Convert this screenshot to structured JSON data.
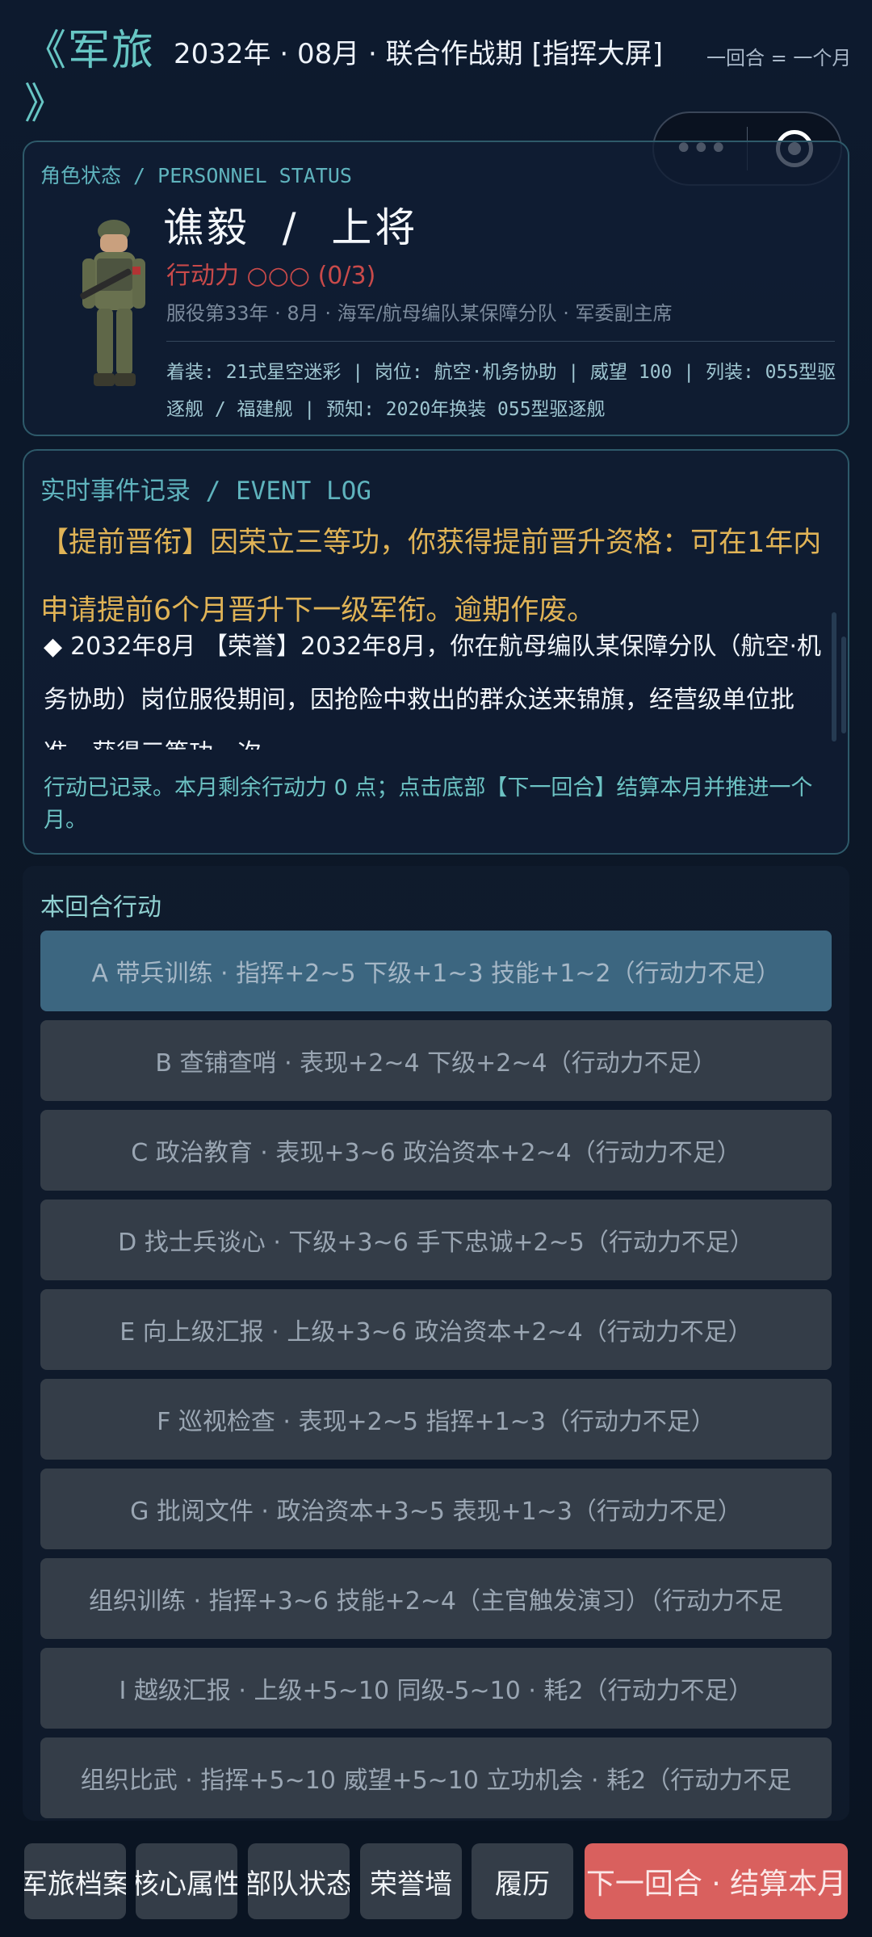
{
  "header": {
    "brand_line1": "《军旅",
    "brand_line2": "》",
    "date_line": "2032年 · 08月 · 联合作战期 [指挥大屏]",
    "turn_note": "一回合 = 一个月"
  },
  "capsule": {
    "more_label": "•••"
  },
  "status": {
    "label": "角色状态 / PERSONNEL STATUS",
    "name_rank": "谯毅  /  上将",
    "action_points": "行动力 ○○○ (0/3)",
    "service": "服役第33年 · 8月 · 海军/航母编队某保障分队 · 军委副主席",
    "details": "着装: 21式星空迷彩 | 岗位: 航空·机务协助 | 威望 100 | 列装: 055型驱逐舰 / 福建舰 | 预知: 2020年换装 055型驱逐舰"
  },
  "event_log": {
    "label": "实时事件记录 / EVENT LOG",
    "highlight": "【提前晋衔】因荣立三等功，你获得提前晋升资格：可在1年内申请提前6个月晋升下一级军衔。逾期作废。",
    "entry_bullet": "◆",
    "entry": "2032年8月 【荣誉】2032年8月，你在航母编队某保障分队（航空·机务协助）岗位服役期间，因抢险中救出的群众送来锦旗，经营级单位批准，获得三等功一次。",
    "footer": "行动已记录。本月剩余行动力 0 点；点击底部【下一回合】结算本月并推进一个月。"
  },
  "actions": {
    "title": "本回合行动",
    "items": [
      "A  带兵训练 · 指挥+2~5 下级+1~3 技能+1~2（行动力不足）",
      "B  查铺查哨 · 表现+2~4 下级+2~4（行动力不足）",
      "C  政治教育 · 表现+3~6 政治资本+2~4（行动力不足）",
      "D  找士兵谈心 · 下级+3~6 手下忠诚+2~5（行动力不足）",
      "E  向上级汇报 · 上级+3~6 政治资本+2~4（行动力不足）",
      "F  巡视检查 · 表现+2~5 指挥+1~3（行动力不足）",
      "G  批阅文件 · 政治资本+3~5 表现+1~3（行动力不足）",
      "组织训练 · 指挥+3~6 技能+2~4（主官触发演习）（行动力不足",
      "I  越级汇报 · 上级+5~10 同级-5~10 · 耗2（行动力不足）",
      "组织比武 · 指挥+5~10 威望+5~10 立功机会 · 耗2（行动力不足"
    ]
  },
  "tabs": {
    "archive": "军旅档案",
    "attributes": "核心属性",
    "unit": "部队状态",
    "honor": "荣誉墙",
    "resume": "履历",
    "next_turn": "下一回合 · 结算本月"
  },
  "colors": {
    "accent_teal": "#67c6c4",
    "warning_red": "#c94a4a",
    "highlight_gold": "#e0b356",
    "primary_button": "#d9605e"
  }
}
